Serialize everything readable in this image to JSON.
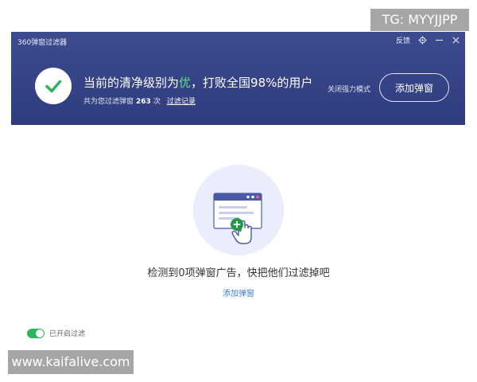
{
  "watermarks": {
    "top": "TG: MYYJJPP",
    "bottom": "www.kaifalive.com"
  },
  "window": {
    "title": "360弹窗过滤器",
    "feedback_label": "反馈",
    "controls": {
      "settings_icon": "gear-icon",
      "minimize_icon": "minimize-icon",
      "close_icon": "close-icon"
    }
  },
  "header": {
    "status_icon": "check-icon",
    "headline_before": "当前的清净级别为",
    "headline_level": "优",
    "headline_after": "，打败全国98%的用户",
    "sub_prefix": "共为您过滤弹窗",
    "sub_count": "263",
    "sub_unit": "次",
    "log_link": "过滤记录",
    "strong_mode_label": "关闭强力模式",
    "add_button_label": "添加弹窗"
  },
  "main": {
    "illustration_icon": "popup-window-add-icon",
    "empty_message": "检测到0项弹窗广告，快把他们过滤掉吧",
    "add_link": "添加弹窗"
  },
  "footer": {
    "toggle_on": true,
    "toggle_label": "已开启过滤"
  },
  "colors": {
    "header_bg": "#34418a",
    "accent_green": "#2db55d",
    "level_green": "#5fe082",
    "link_blue": "#3a7bd5"
  }
}
